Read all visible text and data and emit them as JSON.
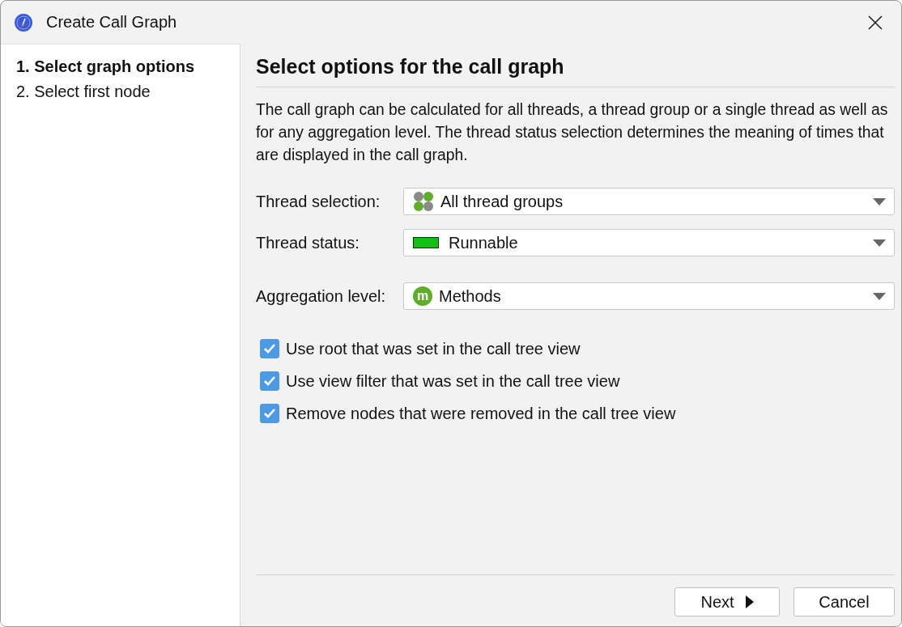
{
  "window": {
    "title": "Create Call Graph"
  },
  "steps": [
    {
      "label": "1. Select graph options",
      "selected": true
    },
    {
      "label": "2. Select first node",
      "selected": false
    }
  ],
  "heading": "Select options for the call graph",
  "description": "The call graph can be calculated for all threads, a thread group or a single thread as well as for any aggregation level. The thread status selection determines the meaning of times that are displayed in the call graph.",
  "fields": [
    {
      "label": "Thread selection:",
      "kind": "thread-groups",
      "value": "All thread groups"
    },
    {
      "label": "Thread status:",
      "kind": "status",
      "value": "Runnable"
    },
    {
      "label": "Aggregation level:",
      "kind": "methods",
      "badge": "m",
      "value": "Methods"
    }
  ],
  "options": [
    {
      "label": "Use root that was set in the call tree view",
      "checked": true
    },
    {
      "label": "Use view filter that was set in the call tree view",
      "checked": true
    },
    {
      "label": "Remove nodes that were removed in the call tree view",
      "checked": true
    }
  ],
  "buttons": [
    {
      "label": "Next",
      "kind": "next"
    },
    {
      "label": "Cancel",
      "kind": "cancel"
    }
  ]
}
